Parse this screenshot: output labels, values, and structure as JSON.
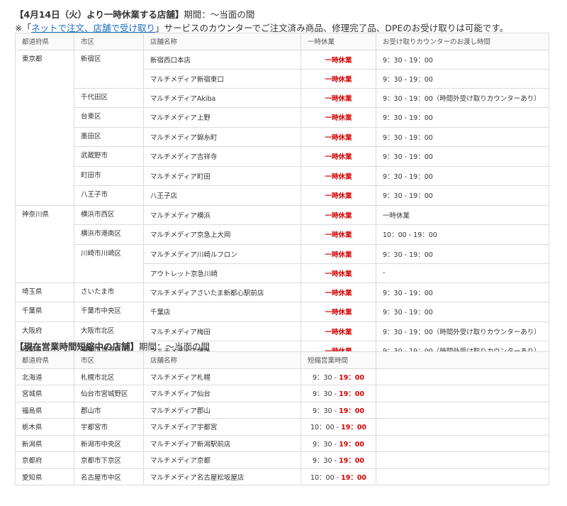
{
  "section1": {
    "title_bold": "【4月14日（火）より一時休業する店舗】",
    "title_rest": "期間：～当面の間",
    "note_prefix": "※「",
    "note_link": "ネットで注文、店舗で受け取り",
    "note_suffix": "」サービスのカウンターでご注文済み商品、修理完了品、DPEのお受け取りは可能です。",
    "headers": [
      "都道府県",
      "市区",
      "店舗名称",
      "一時休業",
      "お受け取りカウンターのお渡し時間"
    ],
    "rows": [
      {
        "pref": "東京都",
        "city": "新宿区",
        "store": "新宿西口本店",
        "status": "一時休業",
        "hours": "9：30 - 19：00"
      },
      {
        "pref": "",
        "city": "",
        "store": "マルチメディア新宿東口",
        "status": "一時休業",
        "hours": "9：30 - 19：00"
      },
      {
        "pref": "",
        "city": "千代田区",
        "store": "マルチメディアAkiba",
        "status": "一時休業",
        "hours": "9：30 - 19：00（時間外受け取りカウンターあり）"
      },
      {
        "pref": "",
        "city": "台東区",
        "store": "マルチメディア上野",
        "status": "一時休業",
        "hours": "9：30 - 19：00"
      },
      {
        "pref": "",
        "city": "墨田区",
        "store": "マルチメディア錦糸町",
        "status": "一時休業",
        "hours": "9：30 - 19：00"
      },
      {
        "pref": "",
        "city": "武蔵野市",
        "store": "マルチメディア吉祥寺",
        "status": "一時休業",
        "hours": "9：30 - 19：00"
      },
      {
        "pref": "",
        "city": "町田市",
        "store": "マルチメディア町田",
        "status": "一時休業",
        "hours": "9：30 - 19：00"
      },
      {
        "pref": "",
        "city": "八王子市",
        "store": "八王子店",
        "status": "一時休業",
        "hours": "9：30 - 19：00"
      },
      {
        "pref": "神奈川県",
        "city": "横浜市西区",
        "store": "マルチメディア横浜",
        "status": "一時休業",
        "hours": "一時休業"
      },
      {
        "pref": "",
        "city": "横浜市港南区",
        "store": "マルチメディア京急上大岡",
        "status": "一時休業",
        "hours": "10：00 - 19：00"
      },
      {
        "pref": "",
        "city": "川崎市川崎区",
        "store": "マルチメディア川崎ルフロン",
        "status": "一時休業",
        "hours": "9：30 - 19：00"
      },
      {
        "pref": "",
        "city": "",
        "store": "アウトレット京急川崎",
        "status": "一時休業",
        "hours": "-"
      },
      {
        "pref": "埼玉県",
        "city": "さいたま市",
        "store": "マルチメディアさいたま新都心駅前店",
        "status": "一時休業",
        "hours": "9：30 - 19：00"
      },
      {
        "pref": "千葉県",
        "city": "千葉市中央区",
        "store": "千葉店",
        "status": "一時休業",
        "hours": "9：30 - 19：00"
      },
      {
        "pref": "大阪府",
        "city": "大阪市北区",
        "store": "マルチメディア梅田",
        "status": "一時休業",
        "hours": "9：30 - 19：00（時間外受け取りカウンターあり）"
      },
      {
        "pref": "福岡県",
        "city": "福岡市博多区",
        "store": "マルチメディア博多",
        "status": "一時休業",
        "hours": "9：30 - 19：00（時間外受け取りカウンターあり）"
      }
    ]
  },
  "section2": {
    "title_bold": "【現在営業時間短縮中の店舗】",
    "title_rest": "期間：～当面の間",
    "headers": [
      "都道府県",
      "市区",
      "店舗名称",
      "短縮営業時間",
      ""
    ],
    "rows": [
      {
        "pref": "北海道",
        "city": "札幌市北区",
        "store": "マルチメディア札幌",
        "open": "9：30 - ",
        "close": "19：00"
      },
      {
        "pref": "宮城県",
        "city": "仙台市宮城野区",
        "store": "マルチメディア仙台",
        "open": "9：30 - ",
        "close": "19：00"
      },
      {
        "pref": "福島県",
        "city": "郡山市",
        "store": "マルチメディア郡山",
        "open": "9：30 - ",
        "close": "19：00"
      },
      {
        "pref": "栃木県",
        "city": "宇都宮市",
        "store": "マルチメディア宇都宮",
        "open": "10：00 - ",
        "close": "19：00"
      },
      {
        "pref": "新潟県",
        "city": "新潟市中央区",
        "store": "マルチメディア新潟駅前店",
        "open": "9：30 - ",
        "close": "19：00"
      },
      {
        "pref": "京都府",
        "city": "京都市下京区",
        "store": "マルチメディア京都",
        "open": "9：30 - ",
        "close": "19：00"
      },
      {
        "pref": "愛知県",
        "city": "名古屋市中区",
        "store": "マルチメディア名古屋松坂屋店",
        "open": "10：00 - ",
        "close": "19：00"
      }
    ]
  }
}
